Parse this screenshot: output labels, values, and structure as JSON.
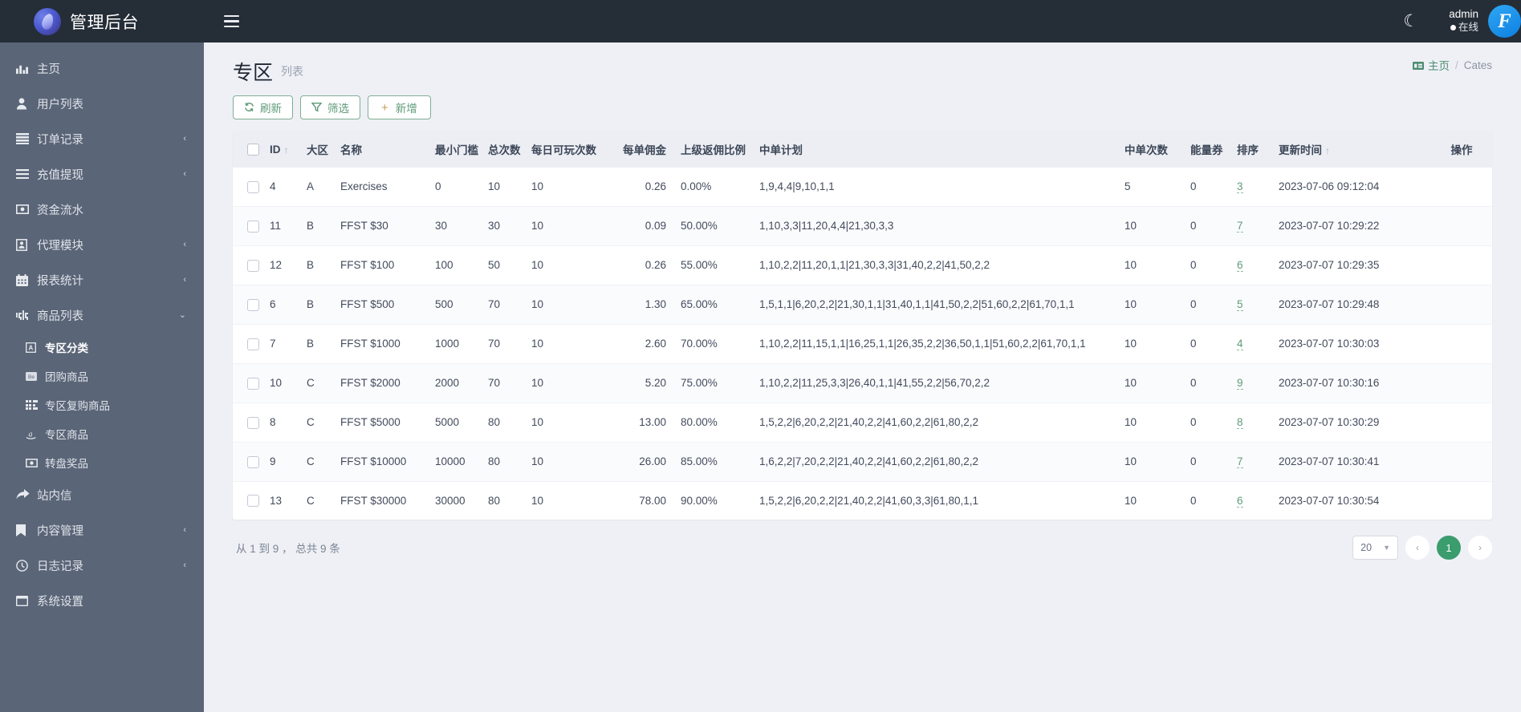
{
  "brand": {
    "title": "管理后台",
    "logo_icon": "brand-logo"
  },
  "topbar": {
    "menu_icon": "hamburger-icon",
    "theme_icon": "moon-icon",
    "user_name": "admin",
    "user_status": "在线",
    "avatar_letter": "F"
  },
  "sidebar": {
    "items": [
      {
        "label": "主页",
        "icon": "chart-bar-icon",
        "caret": ""
      },
      {
        "label": "用户列表",
        "icon": "user-icon",
        "caret": ""
      },
      {
        "label": "订单记录",
        "icon": "list-icon",
        "caret": "‹"
      },
      {
        "label": "充值提现",
        "icon": "bars-icon",
        "caret": "‹"
      },
      {
        "label": "资金流水",
        "icon": "money-icon",
        "caret": ""
      },
      {
        "label": "代理模块",
        "icon": "id-card-icon",
        "caret": "‹"
      },
      {
        "label": "报表统计",
        "icon": "calendar-icon",
        "caret": "‹"
      },
      {
        "label": "商品列表",
        "icon": "digg-icon",
        "caret": "⌄"
      }
    ],
    "sub_items": [
      {
        "label": "专区分类",
        "icon": "square-a-icon",
        "active": true
      },
      {
        "label": "团购商品",
        "icon": "behance-icon",
        "active": false
      },
      {
        "label": "专区复购商品",
        "icon": "grid-icon",
        "active": false
      },
      {
        "label": "专区商品",
        "icon": "amazon-icon",
        "active": false
      },
      {
        "label": "转盘奖品",
        "icon": "money-bill-icon",
        "active": false
      }
    ],
    "items_after": [
      {
        "label": "站内信",
        "icon": "share-arrow-icon",
        "caret": ""
      },
      {
        "label": "内容管理",
        "icon": "bookmark-icon",
        "caret": "‹"
      },
      {
        "label": "日志记录",
        "icon": "clock-icon",
        "caret": "‹"
      },
      {
        "label": "系统设置",
        "icon": "window-icon",
        "caret": ""
      }
    ]
  },
  "page": {
    "title": "专区",
    "subtitle": "列表",
    "breadcrumb_home": "主页",
    "breadcrumb_home_icon": "dashboard-icon",
    "breadcrumb_sep": "/",
    "breadcrumb_current": "Cates"
  },
  "toolbar": {
    "refresh_label": "刷新",
    "refresh_icon": "refresh-icon",
    "filter_label": "筛选",
    "filter_icon": "funnel-icon",
    "add_label": "新增",
    "add_icon": "plus-icon"
  },
  "table": {
    "columns": [
      {
        "key": "checkbox",
        "label": ""
      },
      {
        "key": "id",
        "label": "ID",
        "sort": "↑"
      },
      {
        "key": "zone",
        "label": "大区"
      },
      {
        "key": "name",
        "label": "名称"
      },
      {
        "key": "min",
        "label": "最小门槛"
      },
      {
        "key": "total",
        "label": "总次数"
      },
      {
        "key": "daily",
        "label": "每日可玩次数"
      },
      {
        "key": "commission",
        "label": "每单佣金"
      },
      {
        "key": "rebate",
        "label": "上级返佣比例"
      },
      {
        "key": "plan",
        "label": "中单计划"
      },
      {
        "key": "hits",
        "label": "中单次数"
      },
      {
        "key": "energy",
        "label": "能量券"
      },
      {
        "key": "rank",
        "label": "排序"
      },
      {
        "key": "updated",
        "label": "更新时间",
        "sort": "↑"
      },
      {
        "key": "actions",
        "label": "操作"
      }
    ],
    "rows": [
      {
        "id": "4",
        "zone": "A",
        "name": "Exercises",
        "min": "0",
        "total": "10",
        "daily": "10",
        "commission": "0.26",
        "rebate": "0.00%",
        "plan": "1,9,4,4|9,10,1,1",
        "hits": "5",
        "energy": "0",
        "rank": "3",
        "updated": "2023-07-06 09:12:04"
      },
      {
        "id": "11",
        "zone": "B",
        "name": "FFST $30",
        "min": "30",
        "total": "30",
        "daily": "10",
        "commission": "0.09",
        "rebate": "50.00%",
        "plan": "1,10,3,3|11,20,4,4|21,30,3,3",
        "hits": "10",
        "energy": "0",
        "rank": "7",
        "updated": "2023-07-07 10:29:22"
      },
      {
        "id": "12",
        "zone": "B",
        "name": "FFST $100",
        "min": "100",
        "total": "50",
        "daily": "10",
        "commission": "0.26",
        "rebate": "55.00%",
        "plan": "1,10,2,2|11,20,1,1|21,30,3,3|31,40,2,2|41,50,2,2",
        "hits": "10",
        "energy": "0",
        "rank": "6",
        "updated": "2023-07-07 10:29:35"
      },
      {
        "id": "6",
        "zone": "B",
        "name": "FFST $500",
        "min": "500",
        "total": "70",
        "daily": "10",
        "commission": "1.30",
        "rebate": "65.00%",
        "plan": "1,5,1,1|6,20,2,2|21,30,1,1|31,40,1,1|41,50,2,2|51,60,2,2|61,70,1,1",
        "hits": "10",
        "energy": "0",
        "rank": "5",
        "updated": "2023-07-07 10:29:48"
      },
      {
        "id": "7",
        "zone": "B",
        "name": "FFST $1000",
        "min": "1000",
        "total": "70",
        "daily": "10",
        "commission": "2.60",
        "rebate": "70.00%",
        "plan": "1,10,2,2|11,15,1,1|16,25,1,1|26,35,2,2|36,50,1,1|51,60,2,2|61,70,1,1",
        "hits": "10",
        "energy": "0",
        "rank": "4",
        "updated": "2023-07-07 10:30:03"
      },
      {
        "id": "10",
        "zone": "C",
        "name": "FFST $2000",
        "min": "2000",
        "total": "70",
        "daily": "10",
        "commission": "5.20",
        "rebate": "75.00%",
        "plan": "1,10,2,2|11,25,3,3|26,40,1,1|41,55,2,2|56,70,2,2",
        "hits": "10",
        "energy": "0",
        "rank": "9",
        "updated": "2023-07-07 10:30:16"
      },
      {
        "id": "8",
        "zone": "C",
        "name": "FFST $5000",
        "min": "5000",
        "total": "80",
        "daily": "10",
        "commission": "13.00",
        "rebate": "80.00%",
        "plan": "1,5,2,2|6,20,2,2|21,40,2,2|41,60,2,2|61,80,2,2",
        "hits": "10",
        "energy": "0",
        "rank": "8",
        "updated": "2023-07-07 10:30:29"
      },
      {
        "id": "9",
        "zone": "C",
        "name": "FFST $10000",
        "min": "10000",
        "total": "80",
        "daily": "10",
        "commission": "26.00",
        "rebate": "85.00%",
        "plan": "1,6,2,2|7,20,2,2|21,40,2,2|41,60,2,2|61,80,2,2",
        "hits": "10",
        "energy": "0",
        "rank": "7",
        "updated": "2023-07-07 10:30:41"
      },
      {
        "id": "13",
        "zone": "C",
        "name": "FFST $30000",
        "min": "30000",
        "total": "80",
        "daily": "10",
        "commission": "78.00",
        "rebate": "90.00%",
        "plan": "1,5,2,2|6,20,2,2|21,40,2,2|41,60,3,3|61,80,1,1",
        "hits": "10",
        "energy": "0",
        "rank": "6",
        "updated": "2023-07-07 10:30:54"
      }
    ]
  },
  "footer": {
    "summary": "从 1 到 9 ， 总共 9 条",
    "page_size": "20",
    "prev_icon": "‹",
    "next_icon": "›",
    "current_page": "1"
  },
  "colors": {
    "accent_green": "#3b9c6d",
    "sidebar": "#5a6577",
    "topbar": "#252d37",
    "page_bg": "#eef0f5"
  }
}
